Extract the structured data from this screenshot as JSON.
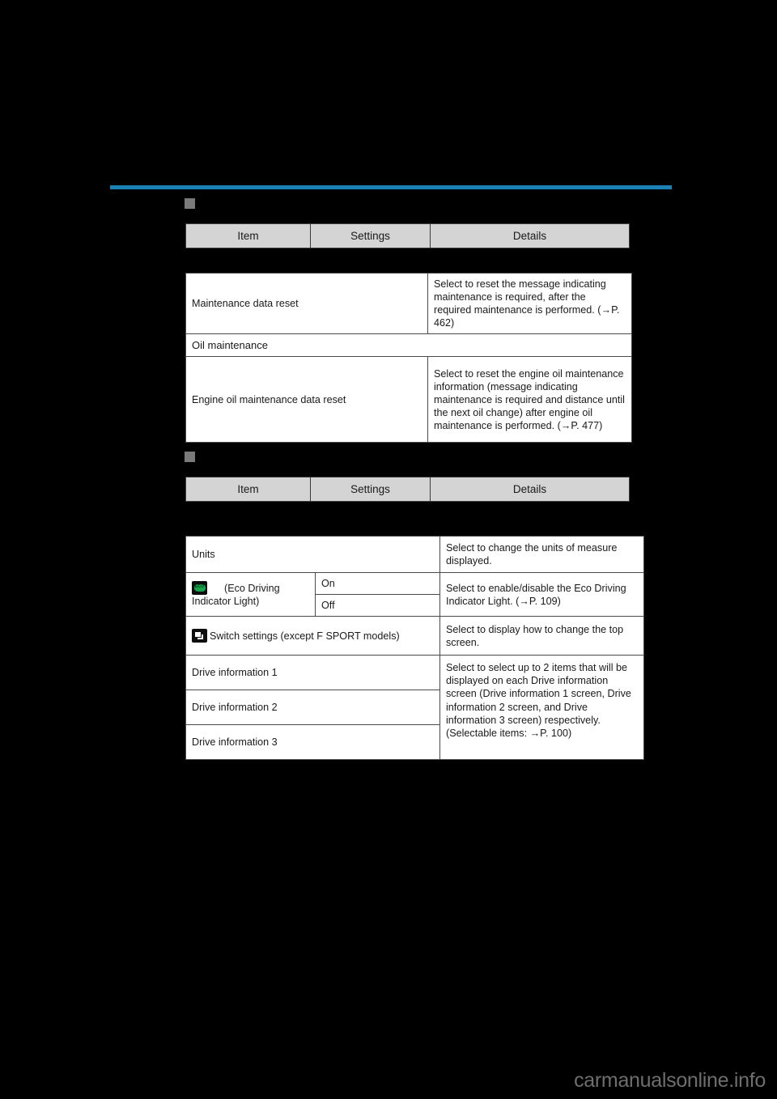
{
  "page": {
    "background_color": "#000000",
    "rule_color": "#1a82b4",
    "header_cell_color": "#d4d4d4",
    "bullet_color": "#7a7a7a",
    "watermark": "carmanualsonline.info"
  },
  "sections": [
    {
      "bullet_label": "",
      "columns": [
        "Item",
        "Settings",
        "Details"
      ],
      "rows": [
        {
          "type": "normal",
          "item": "Maintenance data reset",
          "settings": "",
          "details": "Select to reset the message indicating maintenance is required, after the required maintenance is performed. (→P. 462)"
        },
        {
          "type": "subheading",
          "item": "Oil maintenance"
        },
        {
          "type": "normal",
          "item": "Engine oil maintenance data reset",
          "settings": "",
          "details": "Select to reset the engine oil maintenance information (message indicating maintenance is required and distance until the next oil change) after engine oil maintenance is performed. (→P. 477)"
        }
      ]
    },
    {
      "bullet_label": "",
      "columns": [
        "Item",
        "Settings",
        "Details"
      ],
      "rows": [
        {
          "type": "normal",
          "item": "Units",
          "settings": "",
          "details": "Select to change the units of measure displayed."
        },
        {
          "type": "eco",
          "icon": "eco-indicator-icon",
          "icon_text": "ECO",
          "item": "(Eco Driving Indicator Light)",
          "settings_on": "On",
          "settings_off": "Off",
          "details": "Select to enable/disable the Eco Driving Indicator Light. (→P. 109)"
        },
        {
          "type": "switch",
          "icon": "switch-settings-icon",
          "item": "Switch settings (except F SPORT models)",
          "details": "Select to display how to change the top screen."
        },
        {
          "type": "drive-group",
          "items": [
            "Drive information 1",
            "Drive information 2",
            "Drive information 3"
          ],
          "details": "Select to select up to 2 items that will be displayed on each Drive information screen (Drive information 1 screen, Drive information 2 screen, and Drive information 3 screen) respectively.\n(Selectable items: →P. 100)"
        }
      ]
    }
  ]
}
